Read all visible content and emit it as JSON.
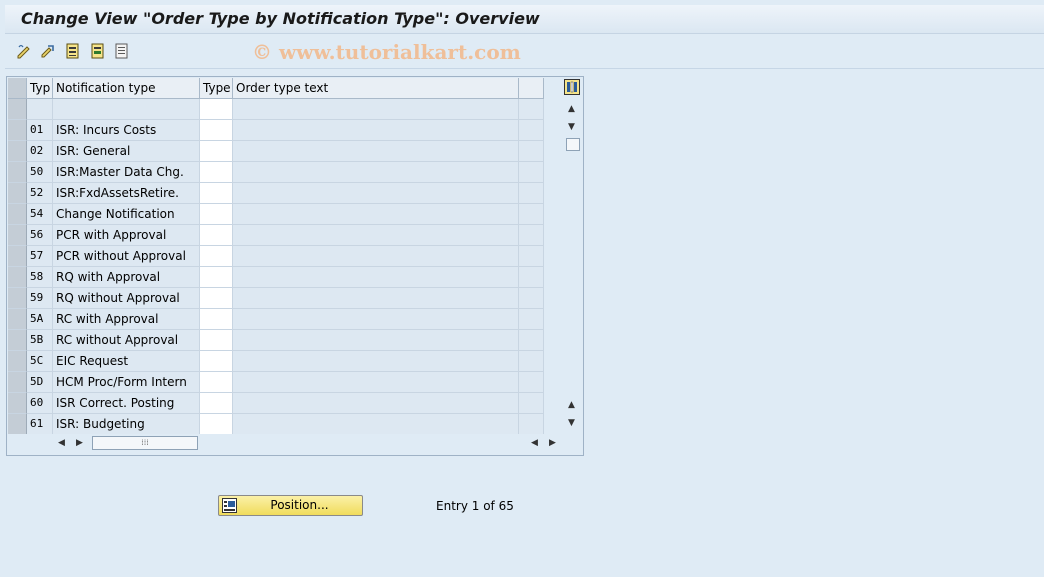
{
  "title": "Change View \"Order Type by Notification Type\": Overview",
  "watermark": "© www.tutorialkart.com",
  "toolbar": {
    "icons": [
      "edit-icon",
      "other-entry-icon",
      "select-all-icon",
      "select-block-icon",
      "deselect-all-icon"
    ]
  },
  "table": {
    "headers": {
      "typ": "Typ",
      "notification_type": "Notification type",
      "type": "Type",
      "order_type_text": "Order type text"
    },
    "rows": [
      {
        "typ": "",
        "ntype": "",
        "type": "",
        "otext": ""
      },
      {
        "typ": "01",
        "ntype": "ISR: Incurs Costs",
        "type": "",
        "otext": ""
      },
      {
        "typ": "02",
        "ntype": "ISR: General",
        "type": "",
        "otext": ""
      },
      {
        "typ": "50",
        "ntype": "ISR:Master Data Chg.",
        "type": "",
        "otext": ""
      },
      {
        "typ": "52",
        "ntype": "ISR:FxdAssetsRetire.",
        "type": "",
        "otext": ""
      },
      {
        "typ": "54",
        "ntype": "Change Notification",
        "type": "",
        "otext": ""
      },
      {
        "typ": "56",
        "ntype": "PCR with Approval",
        "type": "",
        "otext": ""
      },
      {
        "typ": "57",
        "ntype": "PCR without Approval",
        "type": "",
        "otext": ""
      },
      {
        "typ": "58",
        "ntype": "RQ with Approval",
        "type": "",
        "otext": ""
      },
      {
        "typ": "59",
        "ntype": "RQ without Approval",
        "type": "",
        "otext": ""
      },
      {
        "typ": "5A",
        "ntype": "RC with Approval",
        "type": "",
        "otext": ""
      },
      {
        "typ": "5B",
        "ntype": "RC without Approval",
        "type": "",
        "otext": ""
      },
      {
        "typ": "5C",
        "ntype": "EIC Request",
        "type": "",
        "otext": ""
      },
      {
        "typ": "5D",
        "ntype": "HCM Proc/Form Intern",
        "type": "",
        "otext": ""
      },
      {
        "typ": "60",
        "ntype": "ISR Correct. Posting",
        "type": "",
        "otext": ""
      },
      {
        "typ": "61",
        "ntype": "ISR: Budgeting",
        "type": "",
        "otext": ""
      }
    ]
  },
  "position_button": {
    "label": "Position..."
  },
  "entry_status": "Entry 1 of 65",
  "colors": {
    "accent": "#f0dc5c",
    "background": "#dfebf5",
    "watermark": "#f2b889"
  }
}
